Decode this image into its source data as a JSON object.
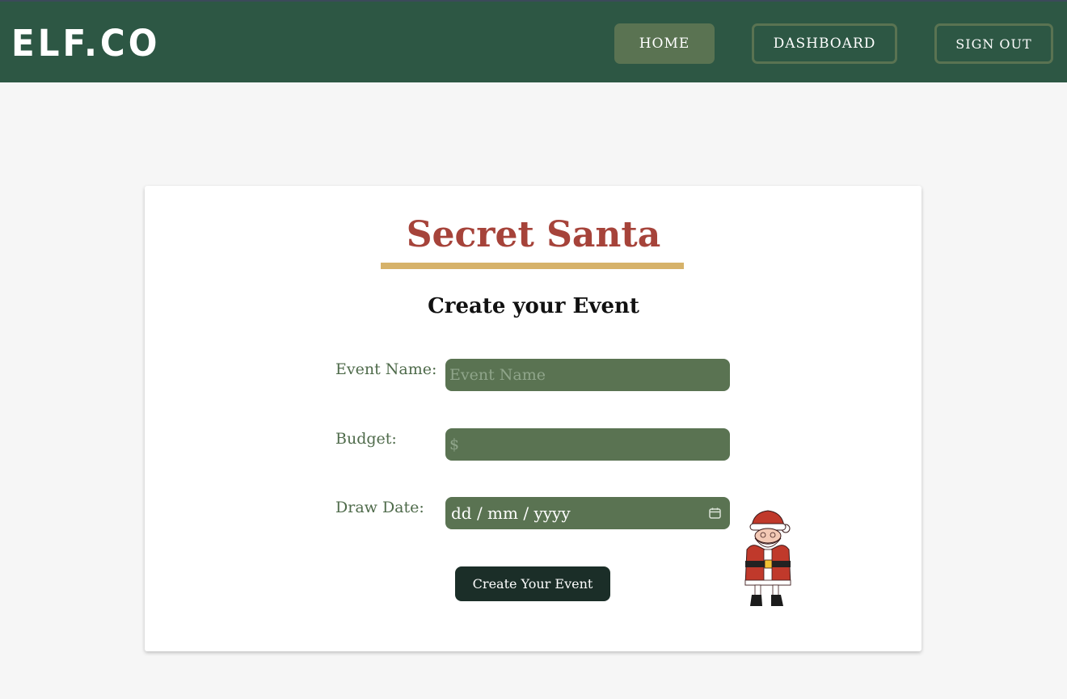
{
  "header": {
    "logo": "ELF.CO",
    "nav": {
      "home": "HOME",
      "dashboard": "DASHBOARD",
      "sign_out": "SIGN OUT"
    }
  },
  "card": {
    "title": "Secret Santa",
    "subtitle": "Create your Event",
    "form": {
      "event_name": {
        "label": "Event Name:",
        "placeholder": "Event Name",
        "value": ""
      },
      "budget": {
        "label": "Budget:",
        "placeholder": "$",
        "value": ""
      },
      "draw_date": {
        "label": "Draw Date:",
        "placeholder": "dd / mm / yyyy",
        "icon": "calendar-icon"
      },
      "submit_label": "Create Your Event"
    },
    "illustration": "santa-illustration"
  },
  "colors": {
    "nav_bg": "#2d5744",
    "nav_accent": "#5a7352",
    "title": "#a6433a",
    "underline": "#d6b26a",
    "button_dark": "#1b2e28"
  }
}
